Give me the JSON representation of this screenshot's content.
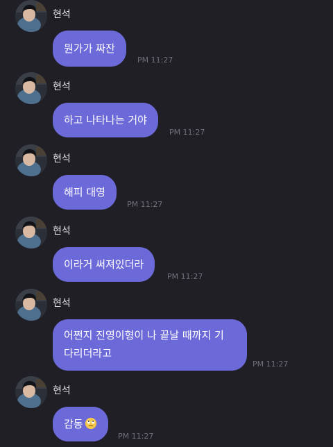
{
  "sender_name": "현석",
  "messages": [
    {
      "text": "뭔가가 짜잔",
      "time": "PM 11:27"
    },
    {
      "text": "하고 나타나는 거야",
      "time": "PM 11:27"
    },
    {
      "text": "해피 대영",
      "time": "PM 11:27"
    },
    {
      "text": "이라거 써져있더라",
      "time": "PM 11:27"
    },
    {
      "text_line1": "어쩐지 진영이형이 나 끝날 때까지 기",
      "text_line2": "다리더라고",
      "time": "PM 11:27"
    },
    {
      "text": "감동",
      "emoji": "rolling-eyes-emoji",
      "time": "PM 11:27"
    }
  ],
  "colors": {
    "background": "#1f1f25",
    "bubble": "#6c69d8",
    "sender": "#e6e6ea",
    "time": "#6f6f78"
  }
}
